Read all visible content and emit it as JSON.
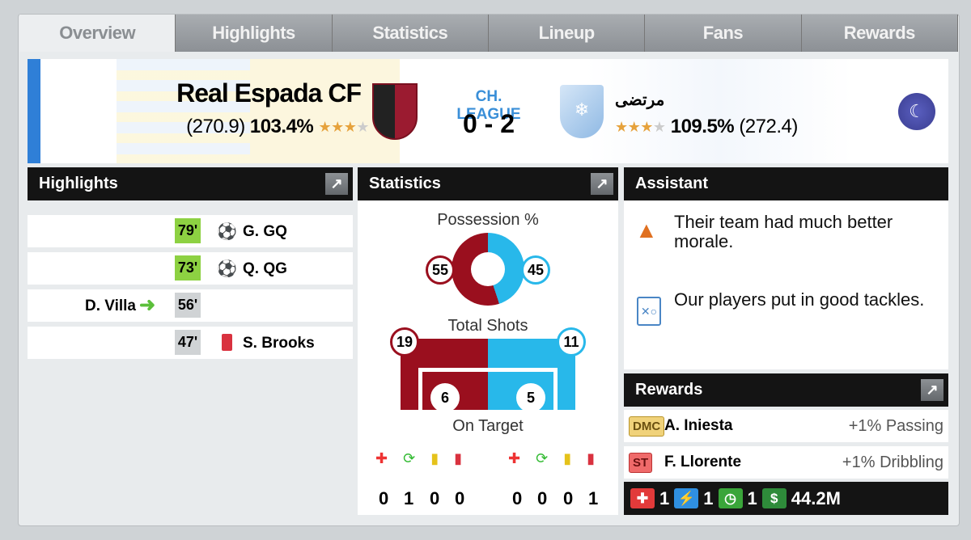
{
  "tabs": [
    "Overview",
    "Highlights",
    "Statistics",
    "Lineup",
    "Fans",
    "Rewards"
  ],
  "active_tab": "Overview",
  "match": {
    "competition": "CH. LEAGUE",
    "score": "0 - 2",
    "home": {
      "name": "Real Espada CF",
      "rating": "(270.9)",
      "percent": "103.4%",
      "stars": 3.5,
      "color": "#2f7fd7"
    },
    "away": {
      "name": "مرتضى",
      "rating": "(272.4)",
      "percent": "109.5%",
      "stars": 3.5
    },
    "weather_icon": "night-rain-icon"
  },
  "highlights": {
    "title": "Highlights",
    "events": [
      {
        "minute": "79'",
        "side": "away",
        "type": "goal",
        "player": "G. GQ"
      },
      {
        "minute": "73'",
        "side": "away",
        "type": "goal",
        "player": "Q. QG"
      },
      {
        "minute": "56'",
        "side": "home",
        "type": "substitution",
        "player": "D. Villa"
      },
      {
        "minute": "47'",
        "side": "away",
        "type": "red-card",
        "player": "S. Brooks"
      }
    ]
  },
  "statistics": {
    "title": "Statistics",
    "possession_label": "Possession %",
    "home_possession": "55",
    "away_possession": "45",
    "shots_label": "Total Shots",
    "home_shots": "19",
    "away_shots": "11",
    "on_target_label": "On Target",
    "home_on_target": "6",
    "away_on_target": "5",
    "home_counts": [
      "0",
      "1",
      "0",
      "0"
    ],
    "away_counts": [
      "0",
      "0",
      "0",
      "1"
    ],
    "count_icons": [
      "injury-icon",
      "substitution-icon",
      "yellow-card-icon",
      "red-card-icon"
    ],
    "home_color": "#9a0f1e",
    "away_color": "#28b8ea"
  },
  "assistant": {
    "title": "Assistant",
    "tips": [
      "Their team had much better morale.",
      "Our players put in good tackles."
    ]
  },
  "rewards": {
    "title": "Rewards",
    "players": [
      {
        "position": "DMC",
        "name": "A. Iniesta",
        "bonus": "+1% Passing"
      },
      {
        "position": "ST",
        "name": "F. Llorente",
        "bonus": "+1% Dribbling"
      }
    ],
    "items": {
      "medical": "1",
      "energy": "1",
      "time": "1",
      "money": "44.2M"
    }
  }
}
